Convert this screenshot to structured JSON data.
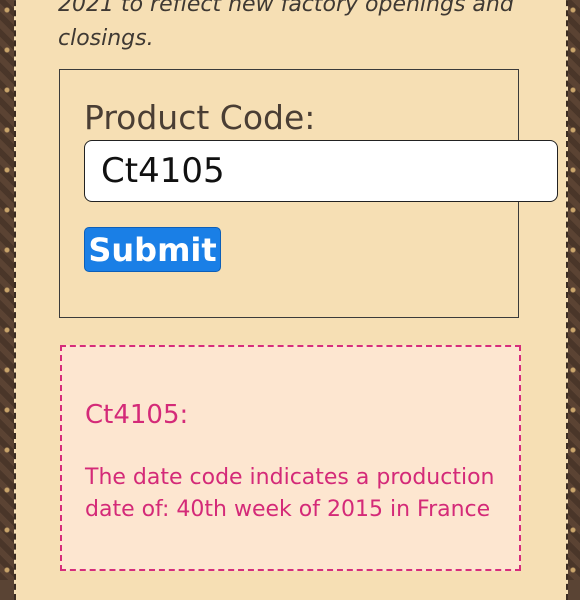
{
  "intro": {
    "text": "2021 to reflect new factory openings and closings."
  },
  "form": {
    "label": "Product Code:",
    "input_value": "Ct4105",
    "submit_label": "Submit"
  },
  "result": {
    "title": "Ct4105:",
    "message": "The date code indicates a production date of: 40th week of 2015 in France"
  },
  "colors": {
    "panel_bg": "#f6dfb4",
    "submit_bg": "#1a7fe6",
    "result_accent": "#d62d7b",
    "result_bg": "#fde6d0"
  }
}
